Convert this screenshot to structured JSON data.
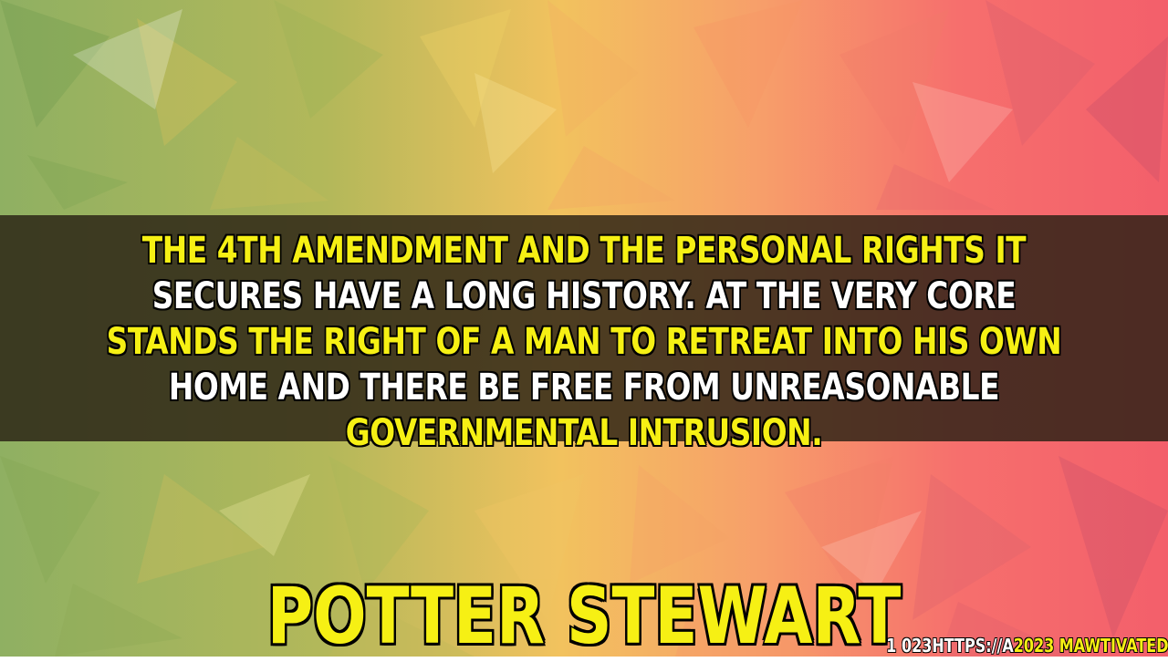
{
  "quote": {
    "lines": [
      {
        "text": "The 4th Amendment and the personal rights it",
        "color": "yellow"
      },
      {
        "text": "secures have a long history. At the very core",
        "color": "white"
      },
      {
        "text": "stands the right of a man to retreat into his own",
        "color": "yellow"
      },
      {
        "text": "home and there be free from unreasonable",
        "color": "white"
      },
      {
        "text": "governmental intrusion.",
        "color": "yellow"
      }
    ]
  },
  "author": "Potter Stewart",
  "watermark": {
    "part1": "1 023HTTPS://A",
    "part2": "2023 MAWTIVATED"
  },
  "colors": {
    "highlight": "#f6f014",
    "secondary": "#ffffff",
    "band": "#282014"
  }
}
